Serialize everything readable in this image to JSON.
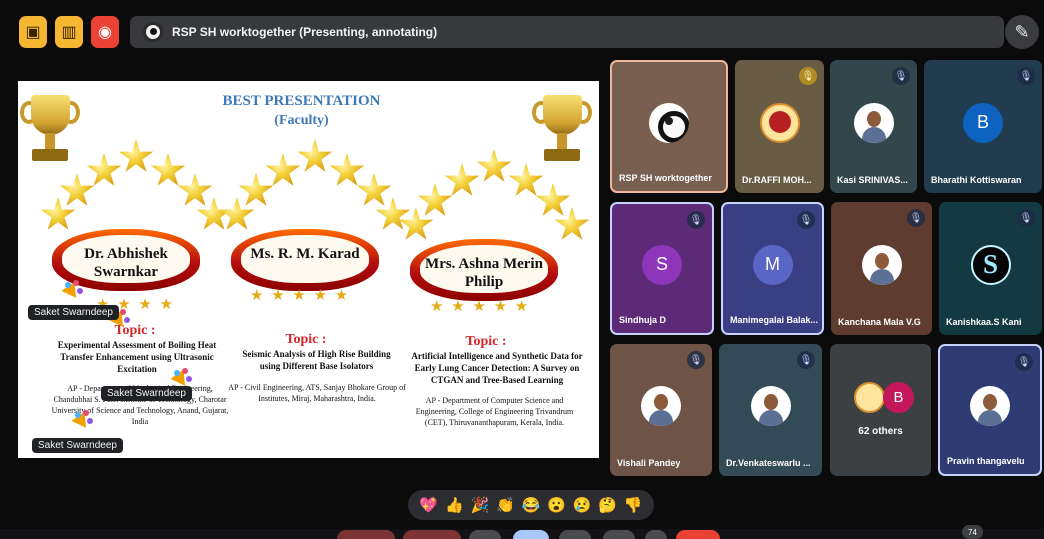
{
  "meeting": {
    "presentation_title": "RSP SH worktogether (Presenting, annotating)"
  },
  "slide": {
    "title_line1": "BEST PRESENTATION",
    "title_line2": "(Faculty)",
    "awardees": [
      {
        "name": "Dr. Abhishek Swarnkar",
        "topic_label": "Topic :",
        "topic": "Experimental Assessment of Boiling Heat Transfer Enhancement using Ultrasonic Excitation",
        "affiliation": "AP - Department of Mechanical Engineering, Chandubhai S. Patel Institute of Technology, Charotar University of Science and Technology, Anand, Gujarat, India"
      },
      {
        "name": "Ms. R. M. Karad",
        "topic_label": "Topic :",
        "topic": "Seismic Analysis of High Rise Building using Different Base Isolators",
        "affiliation": "AP - Civil Engineering, ATS, Sanjay Bhokare Group of Institutes, Miraj, Maharashtra, India."
      },
      {
        "name": "Mrs. Ashna Merin Philip",
        "topic_label": "Topic :",
        "topic": "Artificial Intelligence and Synthetic Data for Early Lung Cancer Detection: A Survey on CTGAN and Tree-Based Learning",
        "affiliation": "AP - Department of Computer Science and Engineering, College of Engineering Trivandrum (CET), Thiruvananthapuram, Kerala, India."
      }
    ],
    "annotations": [
      "Saket Swarndeep",
      "Saket Swarndeep",
      "Saket Swarndeep"
    ]
  },
  "participants": [
    {
      "name": "RSP SH worktogether",
      "type": "logo",
      "muted": false
    },
    {
      "name": "Dr.RAFFI MOH...",
      "type": "seal",
      "muted": true
    },
    {
      "name": "Kasi SRINIVAS...",
      "type": "person",
      "muted": true
    },
    {
      "name": "Bharathi Kottiswaran",
      "type": "letter",
      "letter": "B",
      "muted": true
    },
    {
      "name": "Sindhuja D",
      "type": "letter",
      "letter": "S",
      "muted": true
    },
    {
      "name": "Manimegalai Balak...",
      "type": "letter",
      "letter": "M",
      "muted": true
    },
    {
      "name": "Kanchana Mala V.G",
      "type": "person",
      "muted": true
    },
    {
      "name": "Kanishkaa.S Kani",
      "type": "dark",
      "muted": true
    },
    {
      "name": "Vishali Pandey",
      "type": "person",
      "muted": true
    },
    {
      "name": "Dr.Venkateswarlu ...",
      "type": "person",
      "muted": true
    },
    {
      "name": "62 others",
      "type": "others",
      "muted": false
    },
    {
      "name": "Pravin thangavelu",
      "type": "person",
      "muted": true
    }
  ],
  "reactions": [
    "💖",
    "👍",
    "🎉",
    "👏",
    "😂",
    "😮",
    "😢",
    "🤔",
    "👎"
  ],
  "participant_count": "74",
  "icons": {
    "top_left": [
      "presentation-icon",
      "document-icon",
      "record-icon"
    ],
    "presentation_avatar": "presenter-logo-icon",
    "annotate": "pen-icon",
    "mic": "mic-off-icon"
  },
  "colors": {
    "background": "#0b0b0c",
    "warning": "#f5b731",
    "record": "#ea4335",
    "title_blue": "#3f78b8",
    "topic_red": "#d3262b",
    "tile_dark": "#3c4043"
  }
}
